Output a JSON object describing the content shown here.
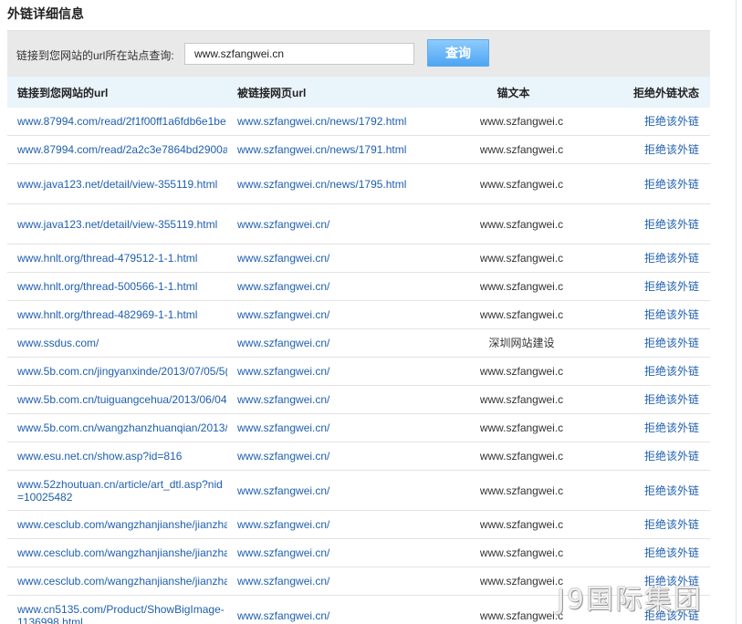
{
  "page_title": "外链详细信息",
  "query": {
    "label": "链接到您网站的url所在站点查询:",
    "value": "www.szfangwei.cn",
    "button_label": "查询"
  },
  "table": {
    "headers": [
      "链接到您网站的url",
      "被链接网页url",
      "锚文本",
      "拒绝外链状态"
    ],
    "rows": [
      {
        "src": "www.87994.com/read/2f1f00ff1a6fdb6e1be",
        "target": "www.szfangwei.cn/news/1792.html",
        "anchor": "www.szfangwei.c",
        "action": "拒绝该外链",
        "tall": false
      },
      {
        "src": "www.87994.com/read/2a2c3e7864bd2900a",
        "target": "www.szfangwei.cn/news/1791.html",
        "anchor": "www.szfangwei.c",
        "action": "拒绝该外链",
        "tall": false
      },
      {
        "src": "www.java123.net/detail/view-355119.html",
        "target": "www.szfangwei.cn/news/1795.html",
        "anchor": "www.szfangwei.c",
        "action": "拒绝该外链",
        "tall": true
      },
      {
        "src": "www.java123.net/detail/view-355119.html",
        "target": "www.szfangwei.cn/",
        "anchor": "www.szfangwei.c",
        "action": "拒绝该外链",
        "tall": true
      },
      {
        "src": "www.hnlt.org/thread-479512-1-1.html",
        "target": "www.szfangwei.cn/",
        "anchor": "www.szfangwei.c",
        "action": "拒绝该外链",
        "tall": false
      },
      {
        "src": "www.hnlt.org/thread-500566-1-1.html",
        "target": "www.szfangwei.cn/",
        "anchor": "www.szfangwei.c",
        "action": "拒绝该外链",
        "tall": false
      },
      {
        "src": "www.hnlt.org/thread-482969-1-1.html",
        "target": "www.szfangwei.cn/",
        "anchor": "www.szfangwei.c",
        "action": "拒绝该外链",
        "tall": false
      },
      {
        "src": "www.ssdus.com/",
        "target": "www.szfangwei.cn/",
        "anchor": "深圳网站建设",
        "action": "拒绝该外链",
        "tall": false
      },
      {
        "src": "www.5b.com.cn/jingyanxinde/2013/07/05/5(",
        "target": "www.szfangwei.cn/",
        "anchor": "www.szfangwei.c",
        "action": "拒绝该外链",
        "tall": false
      },
      {
        "src": "www.5b.com.cn/tuiguangcehua/2013/06/04",
        "target": "www.szfangwei.cn/",
        "anchor": "www.szfangwei.c",
        "action": "拒绝该外链",
        "tall": false
      },
      {
        "src": "www.5b.com.cn/wangzhanzhuanqian/2013/",
        "target": "www.szfangwei.cn/",
        "anchor": "www.szfangwei.c",
        "action": "拒绝该外链",
        "tall": false
      },
      {
        "src": "www.esu.net.cn/show.asp?id=816",
        "target": "www.szfangwei.cn/",
        "anchor": "www.szfangwei.c",
        "action": "拒绝该外链",
        "tall": false
      },
      {
        "src": "www.52zhoutuan.cn/article/art_dtl.asp?nid=10025482",
        "target": "www.szfangwei.cn/",
        "anchor": "www.szfangwei.c",
        "action": "拒绝该外链",
        "tall": true
      },
      {
        "src": "www.cesclub.com/wangzhanjianshe/jianzha",
        "target": "www.szfangwei.cn/",
        "anchor": "www.szfangwei.c",
        "action": "拒绝该外链",
        "tall": false
      },
      {
        "src": "www.cesclub.com/wangzhanjianshe/jianzha",
        "target": "www.szfangwei.cn/",
        "anchor": "www.szfangwei.c",
        "action": "拒绝该外链",
        "tall": false
      },
      {
        "src": "www.cesclub.com/wangzhanjianshe/jianzha",
        "target": "www.szfangwei.cn/",
        "anchor": "www.szfangwei.c",
        "action": "拒绝该外链",
        "tall": false
      },
      {
        "src": "www.cn5135.com/Product/ShowBigImage-1136998.html",
        "target": "www.szfangwei.cn/",
        "anchor": "www.szfangwei.c",
        "action": "拒绝该外链",
        "tall": true
      }
    ]
  },
  "watermark": "J9国际集团",
  "colors": {
    "link": "#1f5fae",
    "header_bg": "#eaf4fb",
    "query_bar_bg": "#e9e9e9",
    "button_bg": "#4da5f2"
  }
}
